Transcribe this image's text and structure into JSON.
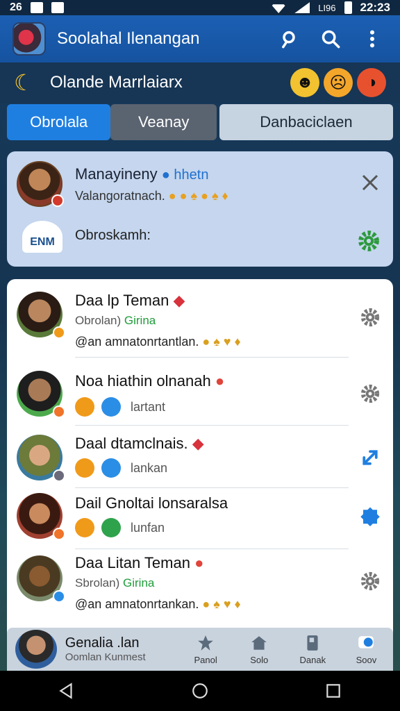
{
  "status": {
    "left_text": "26",
    "right_small": "LI96",
    "time": "22:23"
  },
  "app": {
    "title": "Soolahal Ilenangan"
  },
  "sub": {
    "title": "Olande Marrlaiarx"
  },
  "tabs": [
    {
      "label": "Obrolala"
    },
    {
      "label": "Veanay"
    },
    {
      "label": "Danbaciclaen"
    }
  ],
  "notification": {
    "name": "Manayineny",
    "tag": "hhetn",
    "message": "Valangoratnach.",
    "logo_text": "ENM",
    "label": "Obroskamh:"
  },
  "chats": [
    {
      "title": "Daa lp Teman",
      "sub_prefix": "Obrolan)",
      "sub_green": "Girina",
      "message": "@an  amnatonrtantlan.",
      "avatar_bg": "#6b4a32",
      "badge": "#f09a1a"
    },
    {
      "title": "Noa hiathin olnanah",
      "icons_label": "lartant",
      "avatar_bg": "#3a5a3a",
      "badge": "#f0742a"
    },
    {
      "title": "Daal dtamclnais.",
      "icons_label": "lankan",
      "avatar_bg": "#8a7040",
      "badge": "#6a6a7a"
    },
    {
      "title": "Dail Gnoltai lonsaralsa",
      "icons_label": "lunfan",
      "avatar_bg": "#7a3a2a",
      "badge": "#f0742a"
    },
    {
      "title": "Daa Litan Teman",
      "sub_prefix": "Sbrolan)",
      "sub_green": "Girina",
      "message": "@an  amnatonrtankan.",
      "avatar_bg": "#4a5a3a",
      "badge": "#2b8ee6"
    }
  ],
  "bottom": {
    "name": "Genalia .lan",
    "sub": "Oomlan Kunmest",
    "tabs": [
      {
        "label": "Panol"
      },
      {
        "label": "Solo"
      },
      {
        "label": "Danak"
      },
      {
        "label": "Soov"
      }
    ]
  }
}
